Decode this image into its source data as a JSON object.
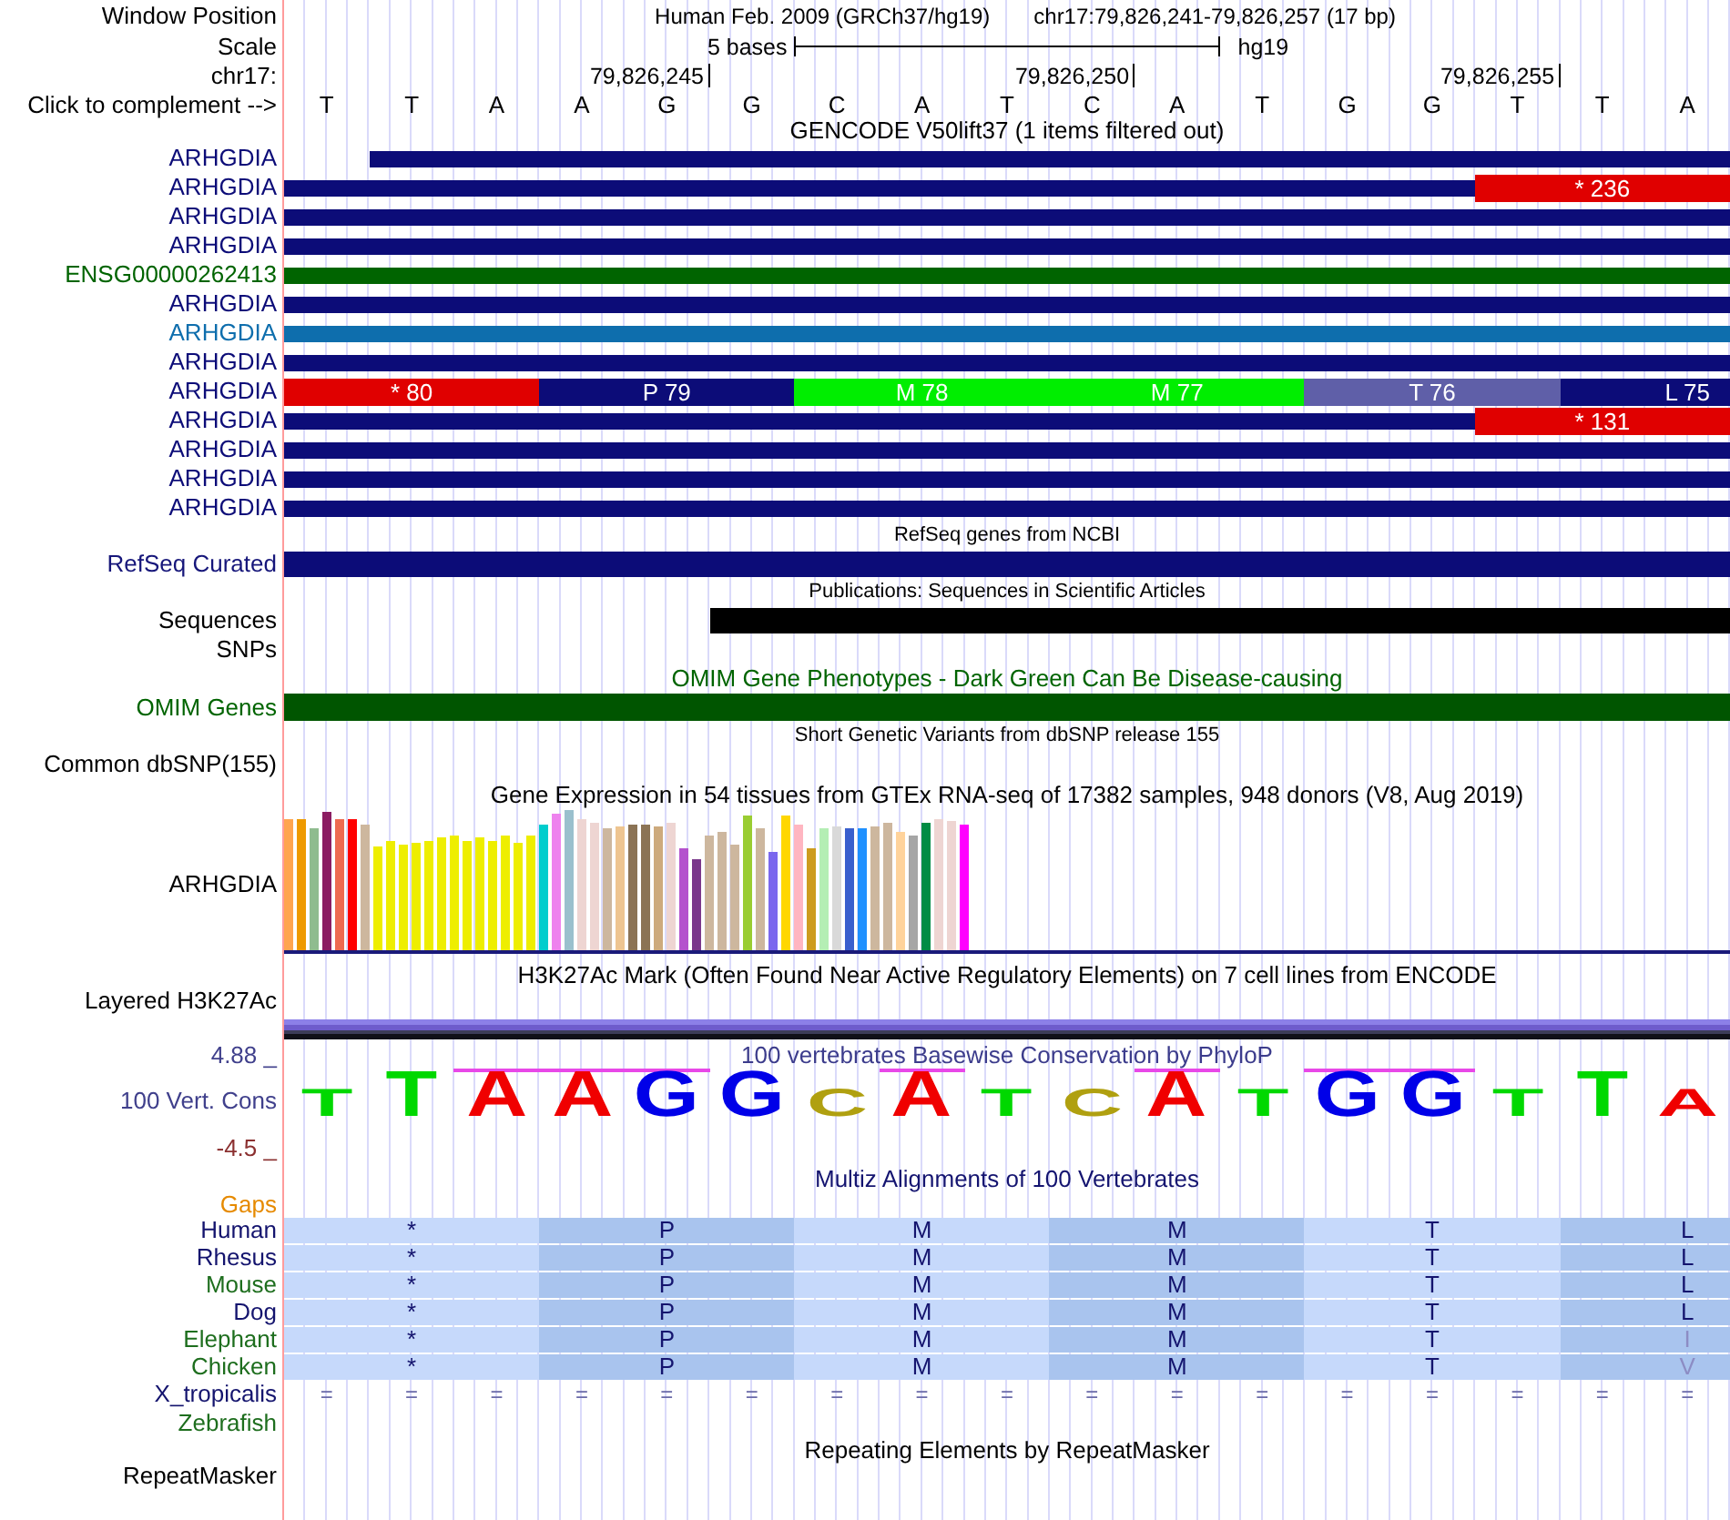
{
  "header": {
    "label": "Window Position",
    "assembly": "Human Feb. 2009 (GRCh37/hg19)",
    "position": "chr17:79,826,241-79,826,257 (17 bp)"
  },
  "scale": {
    "label": "Scale",
    "span": "5 bases",
    "assembly": "hg19"
  },
  "ruler": {
    "label": "chr17:",
    "ticks": [
      "79,826,245",
      "79,826,250",
      "79,826,255"
    ]
  },
  "sequence": {
    "label": "Click to complement -->",
    "bases": [
      "T",
      "T",
      "A",
      "A",
      "G",
      "G",
      "C",
      "A",
      "T",
      "C",
      "A",
      "T",
      "G",
      "G",
      "T",
      "T",
      "A"
    ]
  },
  "gencode": {
    "title": "GENCODE V50lift37 (1 items filtered out)",
    "transcripts": [
      {
        "name": "ARHGDIA",
        "color": "#0c0c78",
        "kind": "thin_late"
      },
      {
        "name": "ARHGDIA",
        "color": "#0c0c78",
        "kind": "thin_then_codons",
        "codons": [
          {
            "label": "* 236",
            "color": "#e00000"
          }
        ]
      },
      {
        "name": "ARHGDIA",
        "color": "#0c0c78",
        "kind": "thin"
      },
      {
        "name": "ARHGDIA",
        "color": "#0c0c78",
        "kind": "thin"
      },
      {
        "name": "ENSG00000262413",
        "color": "#006400",
        "kind": "thin"
      },
      {
        "name": "ARHGDIA",
        "color": "#0c0c78",
        "kind": "thin"
      },
      {
        "name": "ARHGDIA",
        "color": "#0e6ead",
        "kind": "thin"
      },
      {
        "name": "ARHGDIA",
        "color": "#0c0c78",
        "kind": "thin"
      },
      {
        "name": "ARHGDIA",
        "color": "#0c0c78",
        "kind": "codons",
        "codons": [
          {
            "label": "* 80",
            "color": "#e00000"
          },
          {
            "label": "P 79",
            "color": "#0c0c78"
          },
          {
            "label": "M 78",
            "color": "#00ee00"
          },
          {
            "label": "M 77",
            "color": "#00ee00"
          },
          {
            "label": "T 76",
            "color": "#5f5fa8"
          },
          {
            "label": "L 75",
            "color": "#0c0c78"
          }
        ]
      },
      {
        "name": "ARHGDIA",
        "color": "#0c0c78",
        "kind": "thin_then_codons",
        "codons": [
          {
            "label": "* 131",
            "color": "#e00000"
          }
        ]
      },
      {
        "name": "ARHGDIA",
        "color": "#0c0c78",
        "kind": "thin"
      },
      {
        "name": "ARHGDIA",
        "color": "#0c0c78",
        "kind": "thin"
      },
      {
        "name": "ARHGDIA",
        "color": "#0c0c78",
        "kind": "thin"
      }
    ]
  },
  "refseq": {
    "title": "RefSeq genes from NCBI",
    "label": "RefSeq Curated"
  },
  "publications": {
    "title": "Publications: Sequences in Scientific Articles",
    "label": "Sequences",
    "snps_label": "SNPs"
  },
  "omim": {
    "title": "OMIM Gene Phenotypes - Dark Green Can Be Disease-causing",
    "label": "OMIM Genes"
  },
  "dbsnp": {
    "title": "Short Genetic Variants from dbSNP release 155",
    "label": "Common dbSNP(155)"
  },
  "gtex": {
    "title": "Gene Expression in 54 tissues from GTEx RNA-seq of 17382 samples, 948 donors (V8, Aug 2019)",
    "label": "ARHGDIA"
  },
  "h3k27ac": {
    "title": "H3K27Ac Mark (Often Found Near Active Regulatory Elements) on 7 cell lines from ENCODE",
    "label": "Layered H3K27Ac"
  },
  "conservation": {
    "title": "100 vertebrates Basewise Conservation by PhyloP",
    "label": "100 Vert. Cons",
    "axis_max": "4.88 _",
    "axis_min": "-4.5 _",
    "letters": [
      {
        "base": "T",
        "color": "#00d800",
        "kind": "short",
        "conserved": false
      },
      {
        "base": "T",
        "color": "#00d800",
        "kind": "tall",
        "conserved": false
      },
      {
        "base": "A",
        "color": "#f00000",
        "kind": "tall",
        "conserved": true
      },
      {
        "base": "A",
        "color": "#f00000",
        "kind": "tall",
        "conserved": true
      },
      {
        "base": "G",
        "color": "#0000e8",
        "kind": "tall",
        "conserved": true
      },
      {
        "base": "G",
        "color": "#0000e8",
        "kind": "tall",
        "conserved": false
      },
      {
        "base": "C",
        "color": "#b0a010",
        "kind": "short",
        "conserved": false
      },
      {
        "base": "A",
        "color": "#f00000",
        "kind": "tall",
        "conserved": true
      },
      {
        "base": "T",
        "color": "#00d800",
        "kind": "short",
        "conserved": false
      },
      {
        "base": "C",
        "color": "#b0a010",
        "kind": "short",
        "conserved": false
      },
      {
        "base": "A",
        "color": "#f00000",
        "kind": "tall",
        "conserved": true
      },
      {
        "base": "T",
        "color": "#00d800",
        "kind": "short",
        "conserved": false
      },
      {
        "base": "G",
        "color": "#0000e8",
        "kind": "tall",
        "conserved": true
      },
      {
        "base": "G",
        "color": "#0000e8",
        "kind": "tall",
        "conserved": true
      },
      {
        "base": "T",
        "color": "#00d800",
        "kind": "short",
        "conserved": false
      },
      {
        "base": "T",
        "color": "#00d800",
        "kind": "tall",
        "conserved": false
      },
      {
        "base": "A",
        "color": "#f00000",
        "kind": "short",
        "conserved": false
      }
    ]
  },
  "multiz": {
    "title": "Multiz Alignments of 100 Vertebrates",
    "gaps_label": "Gaps",
    "species": [
      {
        "name": "Human",
        "color": "#14146e",
        "kind": "codons",
        "codons": [
          {
            "aa": "*",
            "mismatch": false
          },
          {
            "aa": "P",
            "mismatch": false
          },
          {
            "aa": "M",
            "mismatch": false
          },
          {
            "aa": "M",
            "mismatch": false
          },
          {
            "aa": "T",
            "mismatch": false
          },
          {
            "aa": "L",
            "mismatch": false
          }
        ]
      },
      {
        "name": "Rhesus",
        "color": "#14146e",
        "kind": "codons",
        "codons": [
          {
            "aa": "*",
            "mismatch": false
          },
          {
            "aa": "P",
            "mismatch": false
          },
          {
            "aa": "M",
            "mismatch": false
          },
          {
            "aa": "M",
            "mismatch": false
          },
          {
            "aa": "T",
            "mismatch": false
          },
          {
            "aa": "L",
            "mismatch": false
          }
        ]
      },
      {
        "name": "Mouse",
        "color": "#1e6e1e",
        "kind": "codons",
        "codons": [
          {
            "aa": "*",
            "mismatch": false
          },
          {
            "aa": "P",
            "mismatch": false
          },
          {
            "aa": "M",
            "mismatch": false
          },
          {
            "aa": "M",
            "mismatch": false
          },
          {
            "aa": "T",
            "mismatch": false
          },
          {
            "aa": "L",
            "mismatch": false
          }
        ]
      },
      {
        "name": "Dog",
        "color": "#14146e",
        "kind": "codons",
        "codons": [
          {
            "aa": "*",
            "mismatch": false
          },
          {
            "aa": "P",
            "mismatch": false
          },
          {
            "aa": "M",
            "mismatch": false
          },
          {
            "aa": "M",
            "mismatch": false
          },
          {
            "aa": "T",
            "mismatch": false
          },
          {
            "aa": "L",
            "mismatch": false
          }
        ]
      },
      {
        "name": "Elephant",
        "color": "#1e6e1e",
        "kind": "codons",
        "codons": [
          {
            "aa": "*",
            "mismatch": false
          },
          {
            "aa": "P",
            "mismatch": false
          },
          {
            "aa": "M",
            "mismatch": false
          },
          {
            "aa": "M",
            "mismatch": false
          },
          {
            "aa": "T",
            "mismatch": false
          },
          {
            "aa": "I",
            "mismatch": true
          }
        ]
      },
      {
        "name": "Chicken",
        "color": "#1e6e1e",
        "kind": "codons",
        "codons": [
          {
            "aa": "*",
            "mismatch": false
          },
          {
            "aa": "P",
            "mismatch": false
          },
          {
            "aa": "M",
            "mismatch": false
          },
          {
            "aa": "M",
            "mismatch": false
          },
          {
            "aa": "T",
            "mismatch": false
          },
          {
            "aa": "V",
            "mismatch": true
          }
        ]
      },
      {
        "name": "X_tropicalis",
        "color": "#14146e",
        "kind": "symbols",
        "symbols": [
          "=",
          "=",
          "=",
          "=",
          "=",
          "=",
          "=",
          "=",
          "=",
          "=",
          "=",
          "=",
          "=",
          "=",
          "=",
          "=",
          "="
        ]
      },
      {
        "name": "Zebrafish",
        "color": "#1e6e1e",
        "kind": "empty"
      }
    ]
  },
  "repeatmasker": {
    "title": "Repeating Elements by RepeatMasker",
    "label": "RepeatMasker"
  }
}
